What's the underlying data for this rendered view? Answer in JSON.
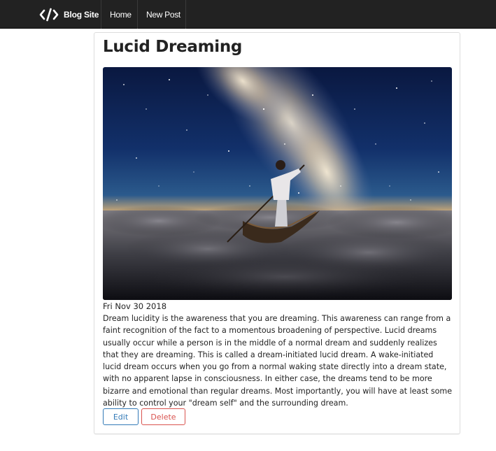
{
  "navbar": {
    "brand_label": "Blog Site",
    "brand_icon": "code-icon",
    "links": [
      {
        "label": "Home"
      },
      {
        "label": "New Post"
      }
    ]
  },
  "post": {
    "title": "Lucid Dreaming",
    "image_icon": "photo-boat-clouds-milky-way",
    "date": "Fri Nov 30 2018",
    "body": "Dream lucidity is the awareness that you are dreaming. This awareness can range from a faint recognition of the fact to a momentous broadening of perspective. Lucid dreams usually occur while a person is in the middle of a normal dream and suddenly realizes that they are dreaming. This is called a dream-initiated lucid dream. A wake-initiated lucid dream occurs when you go from a normal waking state directly into a dream state, with no apparent lapse in consciousness. In either case, the dreams tend to be more bizarre and emotional than regular dreams. Most importantly, you will have at least some ability to control your \"dream self\" and the surrounding dream.",
    "edit_label": "Edit",
    "delete_label": "Delete"
  },
  "colors": {
    "navbar_bg": "#222222",
    "edit_accent": "#337ab7",
    "delete_accent": "#d9534f"
  }
}
